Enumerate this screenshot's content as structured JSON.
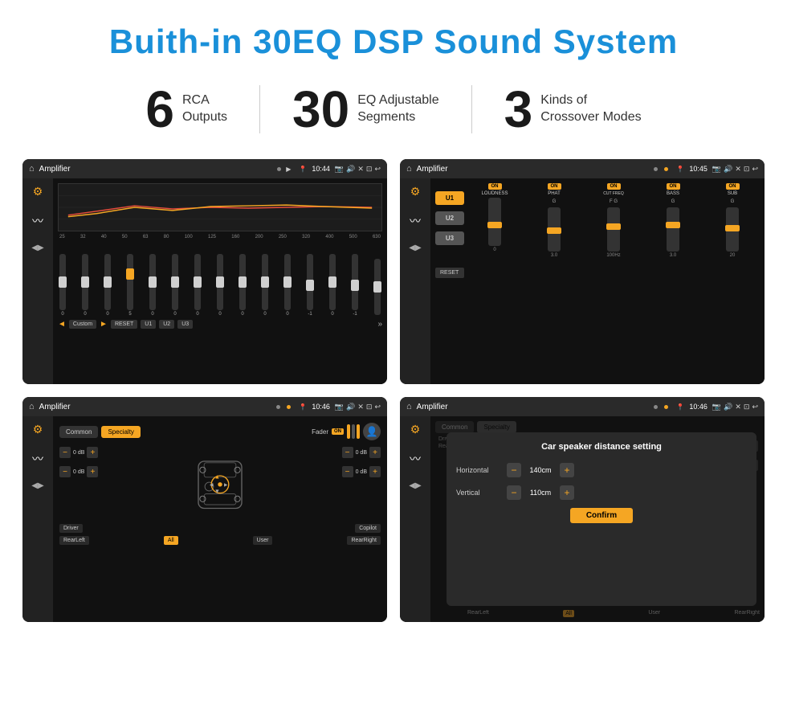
{
  "header": {
    "title": "Buith-in 30EQ DSP Sound System"
  },
  "stats": [
    {
      "number": "6",
      "label_line1": "RCA",
      "label_line2": "Outputs"
    },
    {
      "number": "30",
      "label_line1": "EQ Adjustable",
      "label_line2": "Segments"
    },
    {
      "number": "3",
      "label_line1": "Kinds of",
      "label_line2": "Crossover Modes"
    }
  ],
  "screens": [
    {
      "id": "eq-screen",
      "title": "Amplifier",
      "time": "10:44",
      "type": "equalizer"
    },
    {
      "id": "crossover-screen",
      "title": "Amplifier",
      "time": "10:45",
      "type": "crossover"
    },
    {
      "id": "speaker-screen",
      "title": "Amplifier",
      "time": "10:46",
      "type": "speaker"
    },
    {
      "id": "distance-screen",
      "title": "Amplifier",
      "time": "10:46",
      "type": "distance"
    }
  ],
  "eq": {
    "frequencies": [
      "25",
      "32",
      "40",
      "50",
      "63",
      "80",
      "100",
      "125",
      "160",
      "200",
      "250",
      "320",
      "400",
      "500",
      "630"
    ],
    "values": [
      "0",
      "0",
      "0",
      "5",
      "0",
      "0",
      "0",
      "0",
      "0",
      "0",
      "0",
      "-1",
      "0",
      "-1",
      ""
    ],
    "buttons": [
      "Custom",
      "RESET",
      "U1",
      "U2",
      "U3"
    ]
  },
  "crossover": {
    "presets": [
      "U1",
      "U2",
      "U3"
    ],
    "channels": [
      "LOUDNESS",
      "PHAT",
      "CUT FREQ",
      "BASS",
      "SUB"
    ],
    "channel_states": [
      "ON",
      "ON",
      "ON",
      "ON",
      "ON"
    ]
  },
  "speaker": {
    "tabs": [
      "Common",
      "Specialty"
    ],
    "active_tab": "Specialty",
    "fader_label": "Fader",
    "fader_state": "ON",
    "positions": [
      "Driver",
      "RearLeft",
      "All",
      "User",
      "RearRight",
      "Copilot"
    ],
    "db_values": [
      "0 dB",
      "0 dB",
      "0 dB",
      "0 dB"
    ]
  },
  "distance_dialog": {
    "title": "Car speaker distance setting",
    "horizontal_label": "Horizontal",
    "horizontal_value": "140cm",
    "vertical_label": "Vertical",
    "vertical_value": "110cm",
    "confirm_label": "Confirm"
  }
}
